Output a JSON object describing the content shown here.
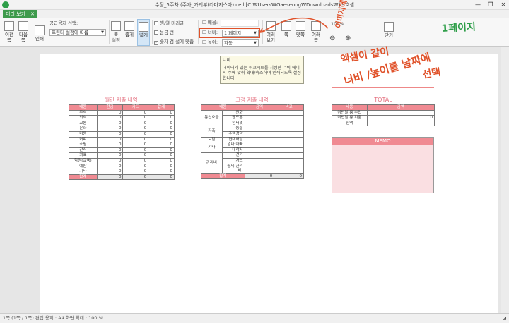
{
  "window": {
    "title": "수정_5주차 (주가_가계부(라마지스마).cell [C:₩Users₩Gaeseong₩Downloads₩] - 호셀",
    "app_icon": "호셀",
    "min": "—",
    "max": "❐",
    "close": "✕"
  },
  "tab": {
    "label": "미리 보기",
    "close": "✕"
  },
  "ribbon": {
    "prev_page": "이전\n쪽",
    "next_page": "다음\n쪽",
    "print": "인쇄",
    "printer_select_label": "공급용지 선택:",
    "printer_value": "프린터 설정에 따름",
    "page_setup": "쪽\n설정",
    "margin_narrow": "좁게",
    "margin_normal": "넓게",
    "row_header": "행/열 머리글",
    "gridlines": "눈금 선",
    "fit_one_page": "숫자 검 설에 맞춤",
    "scale_label": "배율:",
    "width_label": "너비:",
    "width_value": "1 페이지",
    "height_label": "높이:",
    "height_value": "자동",
    "multi_page": "여러\n보기",
    "single_page": "쪽",
    "fit_page": "맞쪽",
    "zoom": "여러\n쪽",
    "zoom_pct": "100%",
    "close": "닫기"
  },
  "tooltip": {
    "title": "너비",
    "body": "데이터가 있는 워크시트를 지정한 너비 페이지 수에 맞춰 확대/축소하여 인쇄되도록 설정합니다."
  },
  "annotations": {
    "a1": "이미지에서",
    "a2": "엑셀이 같이",
    "a3": "너비 /높이를 날짜에",
    "a4": "선택",
    "a5": "1페이지"
  },
  "monthly": {
    "title": "월간 지출 내역",
    "headers": [
      "내용",
      "현금",
      "카드",
      "합계"
    ],
    "rows": [
      [
        "주식",
        "0",
        "0",
        "0"
      ],
      [
        "외식",
        "0",
        "0",
        "0"
      ],
      [
        "교통",
        "0",
        "0",
        "0"
      ],
      [
        "문화",
        "0",
        "0",
        "0"
      ],
      [
        "미용",
        "0",
        "0",
        "0"
      ],
      [
        "커피",
        "0",
        "0",
        "0"
      ],
      [
        "쇼핑",
        "0",
        "0",
        "0"
      ],
      [
        "간식",
        "0",
        "0",
        "0"
      ],
      [
        "의료",
        "0",
        "0",
        "0"
      ],
      [
        "학원(교육)",
        "0",
        "0",
        "0"
      ],
      [
        "예판",
        "0",
        "0",
        "0"
      ],
      [
        "기타",
        "0",
        "0",
        "0"
      ]
    ],
    "total": [
      "합계",
      "0",
      "0",
      "0"
    ]
  },
  "fixed": {
    "title": "고정 지출 내역",
    "headers": [
      "내용",
      "금액",
      "비고"
    ],
    "groups": [
      {
        "cat": "통신요금",
        "items": [
          "전화",
          "핸드폰",
          "인터넷"
        ]
      },
      {
        "cat": "저축",
        "items": [
          "농협",
          "주택청약"
        ]
      },
      {
        "cat": "보험",
        "items": [
          "현대해상"
        ]
      },
      {
        "cat": "기타",
        "items": [
          "엄마,아빠",
          "대학저"
        ]
      },
      {
        "cat": "관리비",
        "items": [
          "전기",
          "가스",
          "월세(관리비)"
        ]
      }
    ],
    "total": [
      "합계",
      "0",
      "0"
    ]
  },
  "total_box": {
    "title": "TOTAL",
    "headers": [
      "내용",
      "금액"
    ],
    "rows": [
      [
        "이번달 총 수입",
        ""
      ],
      [
        "이번달 총 지출",
        "0"
      ],
      [
        "잔액",
        ""
      ]
    ]
  },
  "memo": {
    "title": "MEMO"
  },
  "status": {
    "text": "1쪽 (1쪽 / 1쪽) 편집 용지 : A4   화면 확대 : 100 %"
  }
}
